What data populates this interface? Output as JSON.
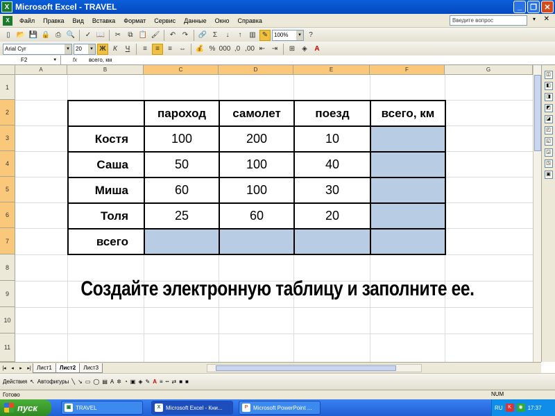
{
  "window": {
    "title": "Microsoft Excel - TRAVEL",
    "app_icon": "X"
  },
  "menu": {
    "items": [
      "Файл",
      "Правка",
      "Вид",
      "Вставка",
      "Формат",
      "Сервис",
      "Данные",
      "Окно",
      "Справка"
    ],
    "help_placeholder": "Введите вопрос"
  },
  "toolbar": {
    "zoom": "100%",
    "font_name": "Arial Cyr",
    "font_size": "20",
    "bold": "Ж",
    "italic": "К",
    "underline": "Ч"
  },
  "formula_bar": {
    "name_box": "F2",
    "fx": "fx",
    "content": "всего, км"
  },
  "columns": [
    "A",
    "B",
    "C",
    "D",
    "E",
    "F",
    "G"
  ],
  "rows": [
    "1",
    "2",
    "3",
    "4",
    "5",
    "6",
    "7",
    "8",
    "9",
    "10",
    "11"
  ],
  "table": {
    "headers": [
      "",
      "пароход",
      "самолет",
      "поезд",
      "всего, км"
    ],
    "rows": [
      {
        "label": "Костя",
        "values": [
          "100",
          "200",
          "10"
        ]
      },
      {
        "label": "Саша",
        "values": [
          "50",
          "100",
          "40"
        ]
      },
      {
        "label": "Миша",
        "values": [
          "60",
          "100",
          "30"
        ]
      },
      {
        "label": "Толя",
        "values": [
          "25",
          "60",
          "20"
        ]
      }
    ],
    "total_label": "всего"
  },
  "instruction": "Создайте электронную таблицу и заполните ее.",
  "sheets": [
    "Лист1",
    "Лист2",
    "Лист3"
  ],
  "active_sheet": "Лист2",
  "drawing": {
    "actions": "Действия",
    "autoshapes": "Автофигуры"
  },
  "status": {
    "ready": "Готово",
    "num": "NUM"
  },
  "taskbar": {
    "start": "пуск",
    "tasks": [
      "TRAVEL",
      "Microsoft Excel - Кни...",
      "Microsoft PowerPoint ..."
    ],
    "lang": "RU",
    "clock": "17:37"
  }
}
